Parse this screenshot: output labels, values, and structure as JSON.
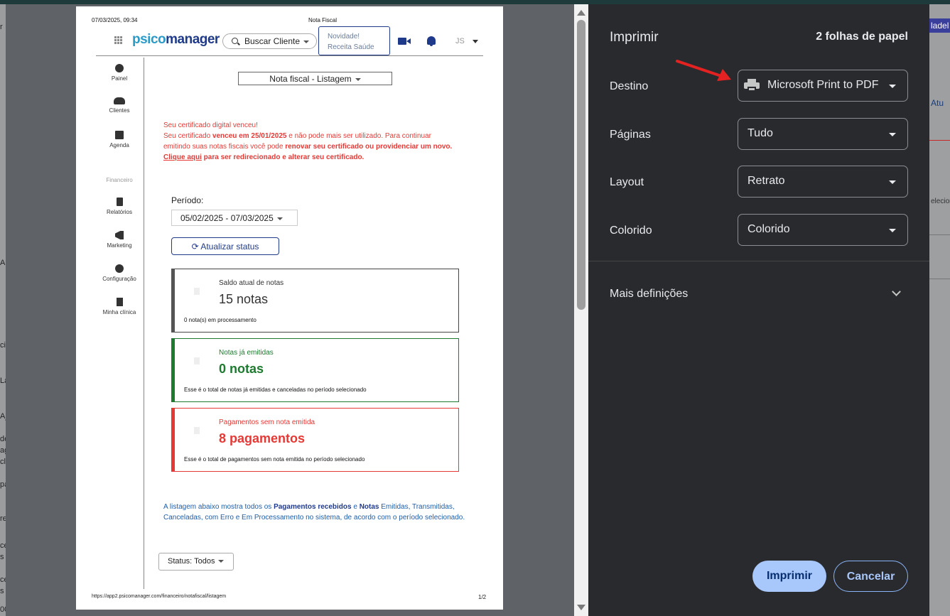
{
  "background": {
    "right_badge": "ladel",
    "right_text_1": "Atu",
    "right_text_2": "elecion",
    "left_letters": [
      "r",
      "A",
      "ci",
      "La",
      "Aj",
      "de",
      "ag",
      "cl",
      "pa",
      "re",
      "ce",
      "s",
      "ce",
      "s",
      "00"
    ]
  },
  "preview": {
    "header_datetime": "07/03/2025, 09:34",
    "header_title": "Nota Fiscal",
    "logo_prefix": "psico",
    "logo_suffix": "manager",
    "search_label": "Buscar Cliente",
    "novidade_line1": "Novidade!",
    "novidade_line2": "Receita Saúde",
    "user_initials": "JS",
    "sidebar": {
      "painel": "Painel",
      "clientes": "Clientes",
      "agenda": "Agenda",
      "section_financeiro": "Financeiro",
      "relatorios": "Relatórios",
      "marketing": "Marketing",
      "configuracao": "Configuração",
      "minha_clinica": "Minha clínica"
    },
    "page_select": "Nota fiscal - Listagem",
    "warning": {
      "title": "Seu certificado digital venceu!",
      "line1_pre": "Seu certificado ",
      "line1_bold": "venceu em 25/01/2025",
      "line1_post": " e não pode mais ser utilizado. Para continuar",
      "line2_pre": "emitindo suas notas fiscais você pode ",
      "line2_bold": "renovar seu certificado ou providenciar um novo.",
      "line3_link": "Clique aqui",
      "line3_post": " para ser redirecionado e alterar seu certificado."
    },
    "periodo_label": "Período:",
    "periodo_value": "05/02/2025 - 07/03/2025",
    "atualizar_label": "Atualizar status",
    "cards": [
      {
        "label": "Saldo atual de notas",
        "value": "15 notas",
        "sub": "0 nota(s) em processamento"
      },
      {
        "label": "Notas já emitidas",
        "value": "0 notas",
        "sub": "Esse é o total de notas já emitidas e canceladas no período selecionado"
      },
      {
        "label": "Pagamentos sem nota emitida",
        "value": "8 pagamentos",
        "sub": "Esse é o total de pagamentos sem nota emitida no período selecionado"
      }
    ],
    "info": {
      "p1": "A listagem abaixo mostra todos os ",
      "b1": "Pagamentos recebidos",
      "p2": " e ",
      "b2": "Notas",
      "p3": " Emitidas, Transmitidas, Canceladas, com Erro e Em Processamento no sistema, de acordo com o período selecionado."
    },
    "status_select": "Status: Todos",
    "footer_url": "https://app2.psicomanager.com/financeiro/notafiscal/listagem",
    "footer_page": "1/2"
  },
  "dialog": {
    "title": "Imprimir",
    "sheets": "2 folhas de papel",
    "destino_label": "Destino",
    "destino_value": "Microsoft Print to PDF",
    "paginas_label": "Páginas",
    "paginas_value": "Tudo",
    "layout_label": "Layout",
    "layout_value": "Retrato",
    "colorido_label": "Colorido",
    "colorido_value": "Colorido",
    "more_label": "Mais definições",
    "print_button": "Imprimir",
    "cancel_button": "Cancelar"
  },
  "colors": {
    "accent_blue": "#a8c7fa",
    "panel_bg": "#292a2d",
    "warning_red": "#e53935",
    "success_green": "#1e7a2e",
    "brand_navy": "#1f3a8a"
  }
}
